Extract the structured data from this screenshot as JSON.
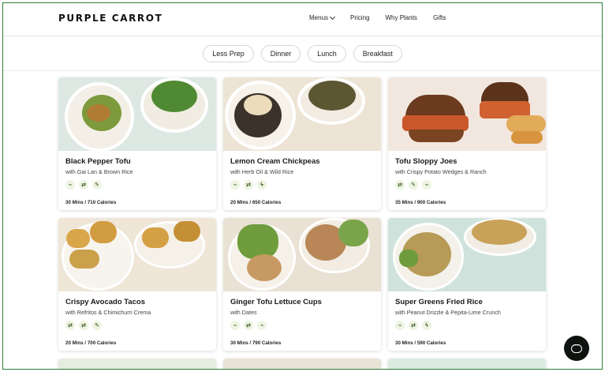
{
  "brand": {
    "logo": "PURPLE CARROT"
  },
  "nav": {
    "items": [
      "Menus",
      "Pricing",
      "Why Plants",
      "Gifts"
    ]
  },
  "filters": [
    "Less Prep",
    "Dinner",
    "Lunch",
    "Breakfast"
  ],
  "cards": [
    {
      "title": "Black Pepper Tofu",
      "subtitle": "with Gai Lan & Brown Rice",
      "meta": "30 Mins / 710 Calories",
      "tags": [
        "leaf-icon",
        "swap-icon",
        "pepper-icon"
      ]
    },
    {
      "title": "Lemon Cream Chickpeas",
      "subtitle": "with Herb Oil & Wild Rice",
      "meta": "20 Mins / 650 Calories",
      "tags": [
        "leaf-icon",
        "swap-icon",
        "bolt-icon"
      ]
    },
    {
      "title": "Tofu Sloppy Joes",
      "subtitle": "with Crispy Potato Wedges & Ranch",
      "meta": "35 Mins / 900 Calories",
      "tags": [
        "swap-icon",
        "pepper-icon",
        "leaf-icon"
      ]
    },
    {
      "title": "Crispy Avocado Tacos",
      "subtitle": "with Refritos & Chimichurri Crema",
      "meta": "20 Mins / 700 Calories",
      "tags": [
        "swap-icon",
        "swap-icon",
        "pepper-icon"
      ]
    },
    {
      "title": "Ginger Tofu Lettuce Cups",
      "subtitle": "with Dates",
      "meta": "30 Mins / 790 Calories",
      "tags": [
        "leaf-icon",
        "swap-icon",
        "leaf-icon"
      ]
    },
    {
      "title": "Super Greens Fried Rice",
      "subtitle": "with Peanut Drizzle & Pepita-Lime Crunch",
      "meta": "30 Mins / 590 Calories",
      "tags": [
        "leaf-icon",
        "swap-icon",
        "bolt-icon"
      ]
    }
  ],
  "icons": {
    "chat": "chat-bubble-icon",
    "menus_chevron": "chevron-down-icon"
  }
}
